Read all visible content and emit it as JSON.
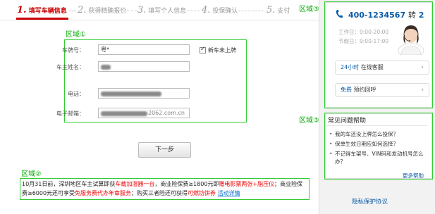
{
  "steps": [
    {
      "num": "1.",
      "label": "填写车辆信息"
    },
    {
      "num": "2.",
      "label": "获得精确报价"
    },
    {
      "num": "3.",
      "label": "填写个人信息"
    },
    {
      "num": "4.",
      "label": "投保确认"
    },
    {
      "num": "5.",
      "label": "支付"
    }
  ],
  "zones": {
    "zone1": "区域①",
    "zone2": "区域②",
    "zone3a": "区域③",
    "zone3b": "区域③"
  },
  "form": {
    "plate_label": "车牌号：",
    "plate_value": "粤*",
    "new_car_label": "新车未上牌",
    "owner_label": "车主姓名：",
    "phone_label": "电话：",
    "email_label": "电子邮箱：",
    "email_suffix": "2062.com.cn",
    "next_button": "下一步"
  },
  "promo": {
    "part1": "10月31日前，深圳地区车主试算即获",
    "part2": "车载加湿器一台",
    "part3": "，商业险保费≥1800元即",
    "part4": "赠电影票两张+脂压仪",
    "part5": "；商业险保费≥6000元还可享受",
    "part6": "免服务费代办年审服务",
    "part7": "；购买三者险还可获得",
    "part8": "可燃坊饼券",
    "link": "活动详情"
  },
  "service": {
    "phone": "400-1234567",
    "ext_prefix": "转",
    "ext": "2",
    "weekday": "工作日：9:00-20:00",
    "holiday": "节假日：9:00-17:00",
    "online_hours": "24小时",
    "online_label": "在线客服",
    "free": "免费",
    "callback": "预约回呼"
  },
  "faq": {
    "title": "常见问题帮助",
    "items": [
      "我的车还没上牌怎么投保？",
      "保单生效日期应如何选择？",
      "不记得车架号、VIN码和发动机号怎么办？"
    ],
    "more": "更多帮助"
  },
  "privacy": "隐私保护协议",
  "colors": {
    "accent_red": "#cc0000",
    "link_blue": "#0a5ba8",
    "annotation_green": "#33cc33"
  }
}
